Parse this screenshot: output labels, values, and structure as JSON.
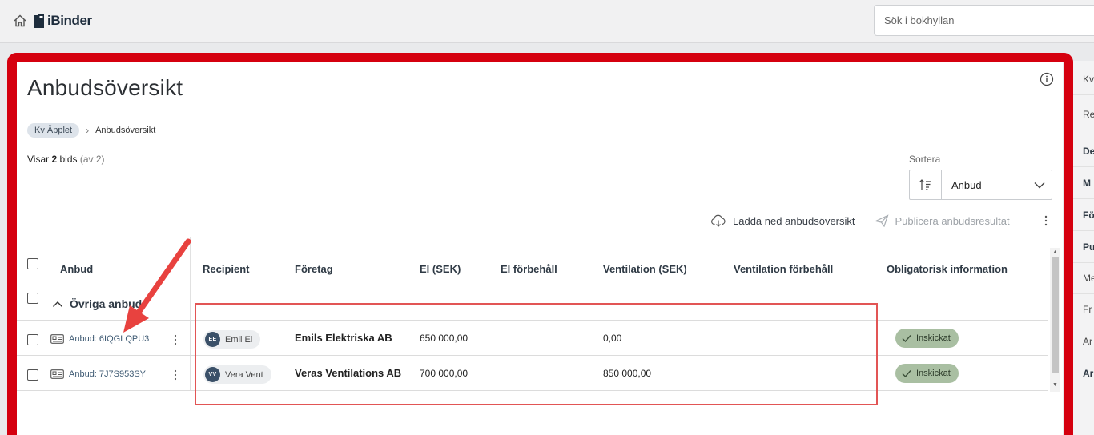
{
  "header": {
    "logo_text": "iBinder",
    "search_placeholder": "Sök i bokhyllan"
  },
  "page": {
    "title": "Anbudsöversikt",
    "breadcrumb": {
      "parent": "Kv Äpplet",
      "current": "Anbudsöversikt"
    },
    "showing": {
      "prefix": "Visar",
      "count": "2",
      "unit": "bids",
      "total": "(av 2)"
    },
    "sort": {
      "label": "Sortera",
      "value": "Anbud"
    },
    "actions": {
      "download": "Ladda ned anbudsöversikt",
      "publish": "Publicera anbudsresultat"
    }
  },
  "table": {
    "headers": {
      "bid": "Anbud",
      "recipient": "Recipient",
      "company": "Företag",
      "el": "El (SEK)",
      "el_reservation": "El förbehåll",
      "ventilation": "Ventilation (SEK)",
      "ventilation_reservation": "Ventilation förbehåll",
      "mandatory": "Obligatorisk information"
    },
    "group": "Övriga anbud",
    "rows": [
      {
        "bid": "Anbud: 6IQGLQPU3",
        "initials": "EE",
        "recipient": "Emil El",
        "company": "Emils Elektriska AB",
        "el": "650 000,00",
        "el_reservation": "",
        "ventilation": "0,00",
        "ventilation_reservation": "",
        "status": "Inskickat"
      },
      {
        "bid": "Anbud: 7J7S953SY",
        "initials": "VV",
        "recipient": "Vera Vent",
        "company": "Veras Ventilations AB",
        "el": "700 000,00",
        "el_reservation": "",
        "ventilation": "850 000,00",
        "ventilation_reservation": "",
        "status": "Inskickat"
      }
    ]
  },
  "right_sidebar": {
    "items": [
      {
        "label": "Kv",
        "bold": false
      },
      {
        "label": "Re",
        "bold": false
      },
      {
        "label": "De",
        "bold": true
      },
      {
        "label": "M",
        "bold": true
      },
      {
        "label": "Fö",
        "bold": true
      },
      {
        "label": "Pu",
        "bold": true
      },
      {
        "label": "Me",
        "bold": false
      },
      {
        "label": "Fr",
        "bold": false
      },
      {
        "label": "Ar",
        "bold": false
      },
      {
        "label": "Ar",
        "bold": true
      }
    ]
  },
  "colors": {
    "annotation_red": "#d5000f",
    "status_badge": "#a9bfa2",
    "avatar": "#3a5068",
    "breadcrumb_pill": "#dde3ea"
  }
}
